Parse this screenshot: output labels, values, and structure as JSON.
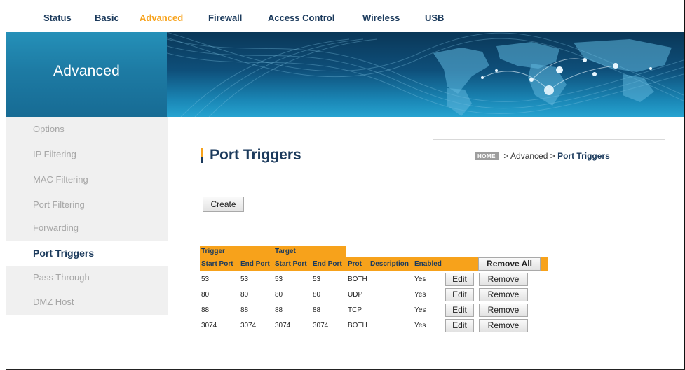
{
  "nav": {
    "items": [
      {
        "label": "Status",
        "active": false
      },
      {
        "label": "Basic",
        "active": false
      },
      {
        "label": "Advanced",
        "active": true
      },
      {
        "label": "Firewall",
        "active": false
      },
      {
        "label": "Access Control",
        "active": false
      },
      {
        "label": "Wireless",
        "active": false
      },
      {
        "label": "USB",
        "active": false
      }
    ]
  },
  "banner": {
    "title": "Advanced"
  },
  "sidebar": {
    "items": [
      {
        "label": "Options"
      },
      {
        "label": "IP Filtering"
      },
      {
        "label": "MAC Filtering"
      },
      {
        "label": "Port Filtering"
      },
      {
        "label": "Forwarding"
      },
      {
        "label": "Port Triggers",
        "active": true
      },
      {
        "label": "Pass Through"
      },
      {
        "label": "DMZ Host"
      }
    ]
  },
  "page": {
    "title": "Port Triggers",
    "breadcrumb": {
      "home": "HOME",
      "section": "> Advanced >",
      "current": "Port Triggers"
    },
    "create_label": "Create"
  },
  "table": {
    "group_headers": {
      "trigger": "Trigger",
      "target": "Target"
    },
    "columns": [
      "Start Port",
      "End Port",
      "Start Port",
      "End Port",
      "Prot",
      "Description",
      "Enabled"
    ],
    "remove_all_label": "Remove All",
    "edit_label": "Edit",
    "remove_label": "Remove",
    "rows": [
      {
        "cells": [
          "53",
          "53",
          "53",
          "53",
          "BOTH",
          "",
          "Yes"
        ]
      },
      {
        "cells": [
          "80",
          "80",
          "80",
          "80",
          "UDP",
          "",
          "Yes"
        ]
      },
      {
        "cells": [
          "88",
          "88",
          "88",
          "88",
          "TCP",
          "",
          "Yes"
        ]
      },
      {
        "cells": [
          "3074",
          "3074",
          "3074",
          "3074",
          "BOTH",
          "",
          "Yes"
        ]
      }
    ]
  },
  "colors": {
    "accent": "#f7a21b",
    "navy": "#1b3a5c",
    "banner_blue": "#1d7ba4"
  }
}
